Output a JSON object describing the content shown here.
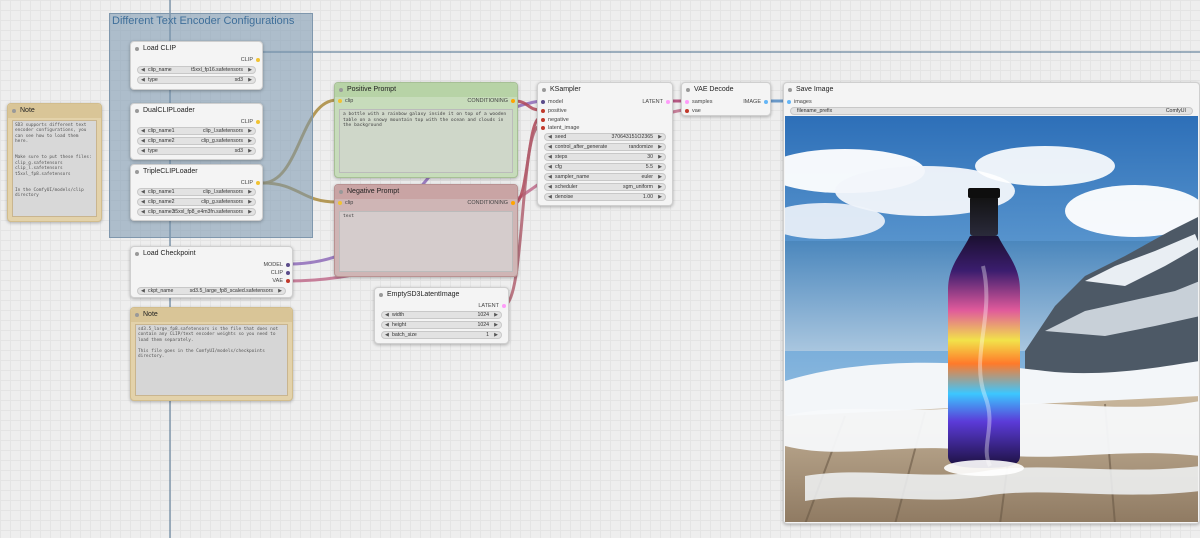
{
  "colors": {
    "canvas_bg": "#eeeeee",
    "group_fill": "#8fa8bf",
    "group_title": "#3f6f9a",
    "positive_header": "#b7d3a6",
    "negative_header": "#c9a4a4",
    "note_fill": "#e6d3a7",
    "link_clip": "#f1c232",
    "link_conditioning": "#ffa500",
    "link_model": "#b39ddb",
    "link_vae": "#ff6e6e",
    "link_latent": "#ff9cf9",
    "link_image": "#64b5f6"
  },
  "group": {
    "title": "Different Text Encoder Configurations"
  },
  "load_clip": {
    "title": "Load CLIP",
    "output": "CLIP",
    "widgets": [
      {
        "name": "clip_name",
        "value": "t5xxl_fp16.safetensors"
      },
      {
        "name": "type",
        "value": "sd3"
      }
    ]
  },
  "dual_clip": {
    "title": "DualCLIPLoader",
    "output": "CLIP",
    "widgets": [
      {
        "name": "clip_name1",
        "value": "clip_l.safetensors"
      },
      {
        "name": "clip_name2",
        "value": "clip_g.safetensors"
      },
      {
        "name": "type",
        "value": "sd3"
      }
    ]
  },
  "triple_clip": {
    "title": "TripleCLIPLoader",
    "output": "CLIP",
    "widgets": [
      {
        "name": "clip_name1",
        "value": "clip_l.safetensors"
      },
      {
        "name": "clip_name2",
        "value": "clip_g.safetensors"
      },
      {
        "name": "clip_name3",
        "value": "t5xxl_fp8_e4m3fn.safetensors"
      }
    ]
  },
  "note1": {
    "title": "Note",
    "text": "SD3 supports different text encoder configurations, you can see how to load them here.\n\n\nMake sure to put these files:\nclip_g.safetensors\nclip_l.safetensors\nt5xxl_fp8.safetensors\n\n\nIn the ComfyUI/models/clip directory"
  },
  "checkpoint": {
    "title": "Load Checkpoint",
    "outputs": [
      "MODEL",
      "CLIP",
      "VAE"
    ],
    "widgets": [
      {
        "name": "ckpt_name",
        "value": "sd3.5_large_fp8_scaled.safetensors"
      }
    ]
  },
  "note2": {
    "title": "Note",
    "text": "sd3.5_large_fp8.safetensors is the file that does not contain any CLIP/text encoder weights so you need to load them separately.\n\nThis file goes in the ComfyUI/models/checkpoints directory."
  },
  "positive": {
    "title": "Positive Prompt",
    "input": "clip",
    "output": "CONDITIONING",
    "text": "a bottle with a rainbow galaxy inside it on top of a wooden table on a snowy mountain top with the ocean and clouds in the background"
  },
  "negative": {
    "title": "Negative Prompt",
    "input": "clip",
    "output": "CONDITIONING",
    "text": "text"
  },
  "latent": {
    "title": "EmptySD3LatentImage",
    "output": "LATENT",
    "widgets": [
      {
        "name": "width",
        "value": "1024"
      },
      {
        "name": "height",
        "value": "1024"
      },
      {
        "name": "batch_size",
        "value": "1"
      }
    ]
  },
  "ksampler": {
    "title": "KSampler",
    "inputs": [
      "model",
      "positive",
      "negative",
      "latent_image"
    ],
    "output": "LATENT",
    "widgets": [
      {
        "name": "seed",
        "value": "370643151O2365"
      },
      {
        "name": "control_after_generate",
        "value": "randomize"
      },
      {
        "name": "steps",
        "value": "30"
      },
      {
        "name": "cfg",
        "value": "5.5"
      },
      {
        "name": "sampler_name",
        "value": "euler"
      },
      {
        "name": "scheduler",
        "value": "sgm_uniform"
      },
      {
        "name": "denoise",
        "value": "1.00"
      }
    ]
  },
  "vae_decode": {
    "title": "VAE Decode",
    "inputs": [
      "samples",
      "vae"
    ],
    "output": "IMAGE"
  },
  "save_image": {
    "title": "Save Image",
    "input": "images",
    "widgets": [
      {
        "name": "filename_prefix",
        "value": "ComfyUI"
      }
    ]
  }
}
